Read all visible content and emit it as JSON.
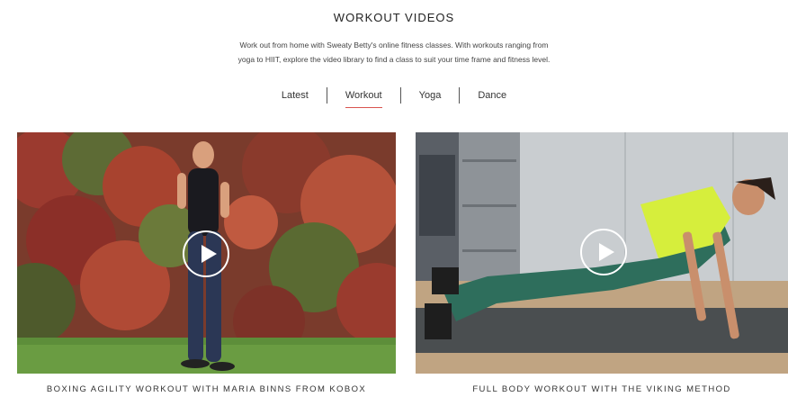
{
  "header": {
    "title": "WORKOUT VIDEOS",
    "intro_line1": "Work out from home with Sweaty Betty's online fitness classes. With workouts ranging from",
    "intro_line2": "yoga to HIIT, explore the video library to find a class to suit your time frame and fitness level."
  },
  "tabs": [
    {
      "label": "Latest",
      "active": false
    },
    {
      "label": "Workout",
      "active": true
    },
    {
      "label": "Yoga",
      "active": false
    },
    {
      "label": "Dance",
      "active": false
    }
  ],
  "videos": [
    {
      "caption": "BOXING AGILITY WORKOUT WITH MARIA BINNS FROM KOBOX",
      "icon": "play-icon"
    },
    {
      "caption": "FULL BODY WORKOUT WITH THE VIKING METHOD",
      "icon": "play-icon"
    }
  ],
  "colors": {
    "tab_underline": "#d9534f",
    "text": "#222222"
  }
}
